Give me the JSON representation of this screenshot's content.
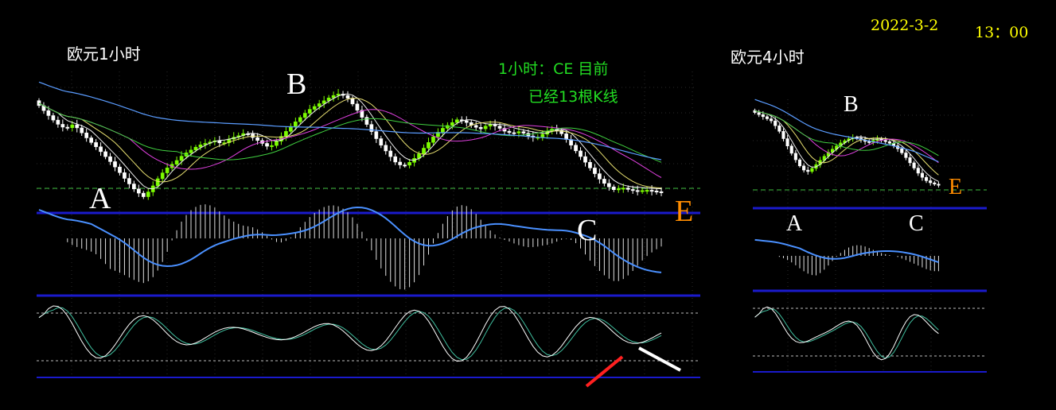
{
  "header": {
    "date": "2022-3-2",
    "time": "13：00"
  },
  "charts": {
    "h1": {
      "title": "欧元1小时",
      "note_line1": "1小时：CE 目前",
      "note_line2": "已经13根K线",
      "labels": {
        "A": "A",
        "B": "B",
        "C": "C",
        "E": "E"
      }
    },
    "h4": {
      "title": "欧元4小时",
      "labels": {
        "A": "A",
        "B": "B",
        "C": "C",
        "E": "E"
      }
    }
  },
  "colors": {
    "background": "#000000",
    "bull": "#7cfc00",
    "bear": "#ffffff",
    "ma_white": "#f0f0f0",
    "ma_yellow": "#e8e070",
    "ma_magenta": "#e040e0",
    "ma_green": "#40d040",
    "ma_blue": "#5a9cff",
    "panel_border": "#1a1acc",
    "support_line": "#40c040",
    "macd_line": "#4a90ff",
    "kdj_k": "#ffffff",
    "kdj_d": "#40c0a0",
    "E_label": "#ff8c00",
    "arrow_up": "#ff2020",
    "arrow_down": "#ffffff"
  },
  "chart_data": [
    {
      "type": "candlestick",
      "symbol": "EUR 1H",
      "price_path": [
        0.82,
        0.75,
        0.68,
        0.62,
        0.58,
        0.62,
        0.55,
        0.48,
        0.42,
        0.35,
        0.28,
        0.2,
        0.12,
        0.05,
        0.0,
        0.08,
        0.18,
        0.25,
        0.3,
        0.36,
        0.4,
        0.44,
        0.46,
        0.48,
        0.45,
        0.5,
        0.52,
        0.55,
        0.5,
        0.46,
        0.42,
        0.48,
        0.55,
        0.62,
        0.68,
        0.74,
        0.78,
        0.82,
        0.86,
        0.88,
        0.84,
        0.76,
        0.66,
        0.56,
        0.46,
        0.38,
        0.3,
        0.26,
        0.3,
        0.36,
        0.44,
        0.52,
        0.58,
        0.62,
        0.66,
        0.64,
        0.6,
        0.58,
        0.62,
        0.6,
        0.56,
        0.54,
        0.56,
        0.52,
        0.5,
        0.54,
        0.58,
        0.56,
        0.48,
        0.4,
        0.32,
        0.24,
        0.16,
        0.1,
        0.06,
        0.08,
        0.06,
        0.05,
        0.06,
        0.05,
        0.04
      ],
      "labels": [
        "A",
        "B",
        "C",
        "E"
      ],
      "indicators": [
        "MA",
        "MACD",
        "KDJ"
      ]
    },
    {
      "type": "candlestick",
      "symbol": "EUR 4H",
      "price_path": [
        0.92,
        0.88,
        0.84,
        0.8,
        0.7,
        0.56,
        0.42,
        0.3,
        0.22,
        0.28,
        0.36,
        0.44,
        0.5,
        0.56,
        0.6,
        0.62,
        0.58,
        0.56,
        0.6,
        0.58,
        0.55,
        0.5,
        0.42,
        0.32,
        0.22,
        0.14,
        0.1,
        0.08
      ],
      "labels": [
        "A",
        "B",
        "C",
        "E"
      ],
      "indicators": [
        "MA",
        "MACD",
        "KDJ"
      ]
    }
  ]
}
